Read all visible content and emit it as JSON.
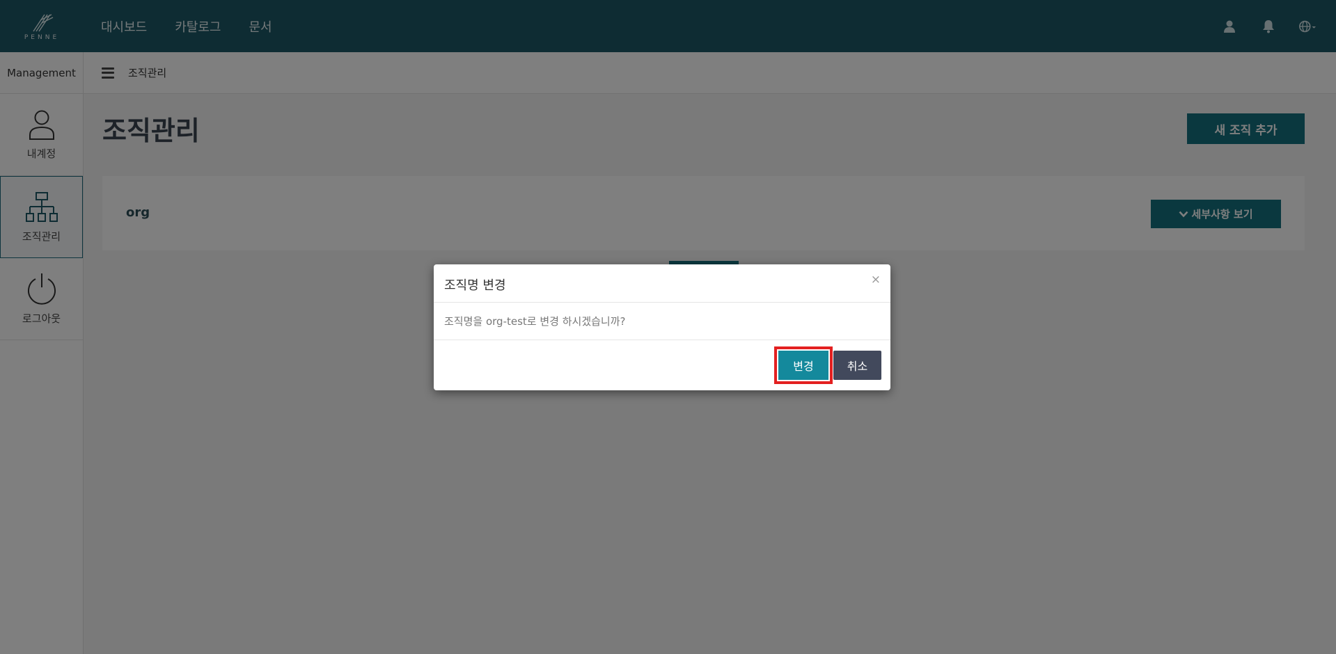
{
  "navbar": {
    "logo_text": "PENNE",
    "links": [
      {
        "label": "대시보드"
      },
      {
        "label": "카탈로그"
      },
      {
        "label": "문서"
      }
    ],
    "icons": [
      "user-icon",
      "bell-icon",
      "globe-icon"
    ]
  },
  "sidebar": {
    "header": "Management",
    "items": [
      {
        "label": "내계정",
        "icon": "user-icon"
      },
      {
        "label": "조직관리",
        "icon": "org-chart-icon",
        "active": true
      },
      {
        "label": "로그아웃",
        "icon": "power-icon"
      }
    ]
  },
  "breadcrumb": {
    "current": "조직관리"
  },
  "main": {
    "title": "조직관리",
    "add_button": "새 조직 추가",
    "org_card": {
      "name": "org",
      "details_button": "세부사항 보기"
    }
  },
  "modal": {
    "title": "조직명 변경",
    "close_symbol": "×",
    "message": "조직명을 org-test로 변경 하시겠습니까?",
    "confirm_label": "변경",
    "cancel_label": "취소"
  },
  "colors": {
    "navbar": "#1d5866",
    "primary_button": "#14707f",
    "confirm_button": "#14899c",
    "cancel_button": "#42495c",
    "highlight": "#e32020"
  }
}
